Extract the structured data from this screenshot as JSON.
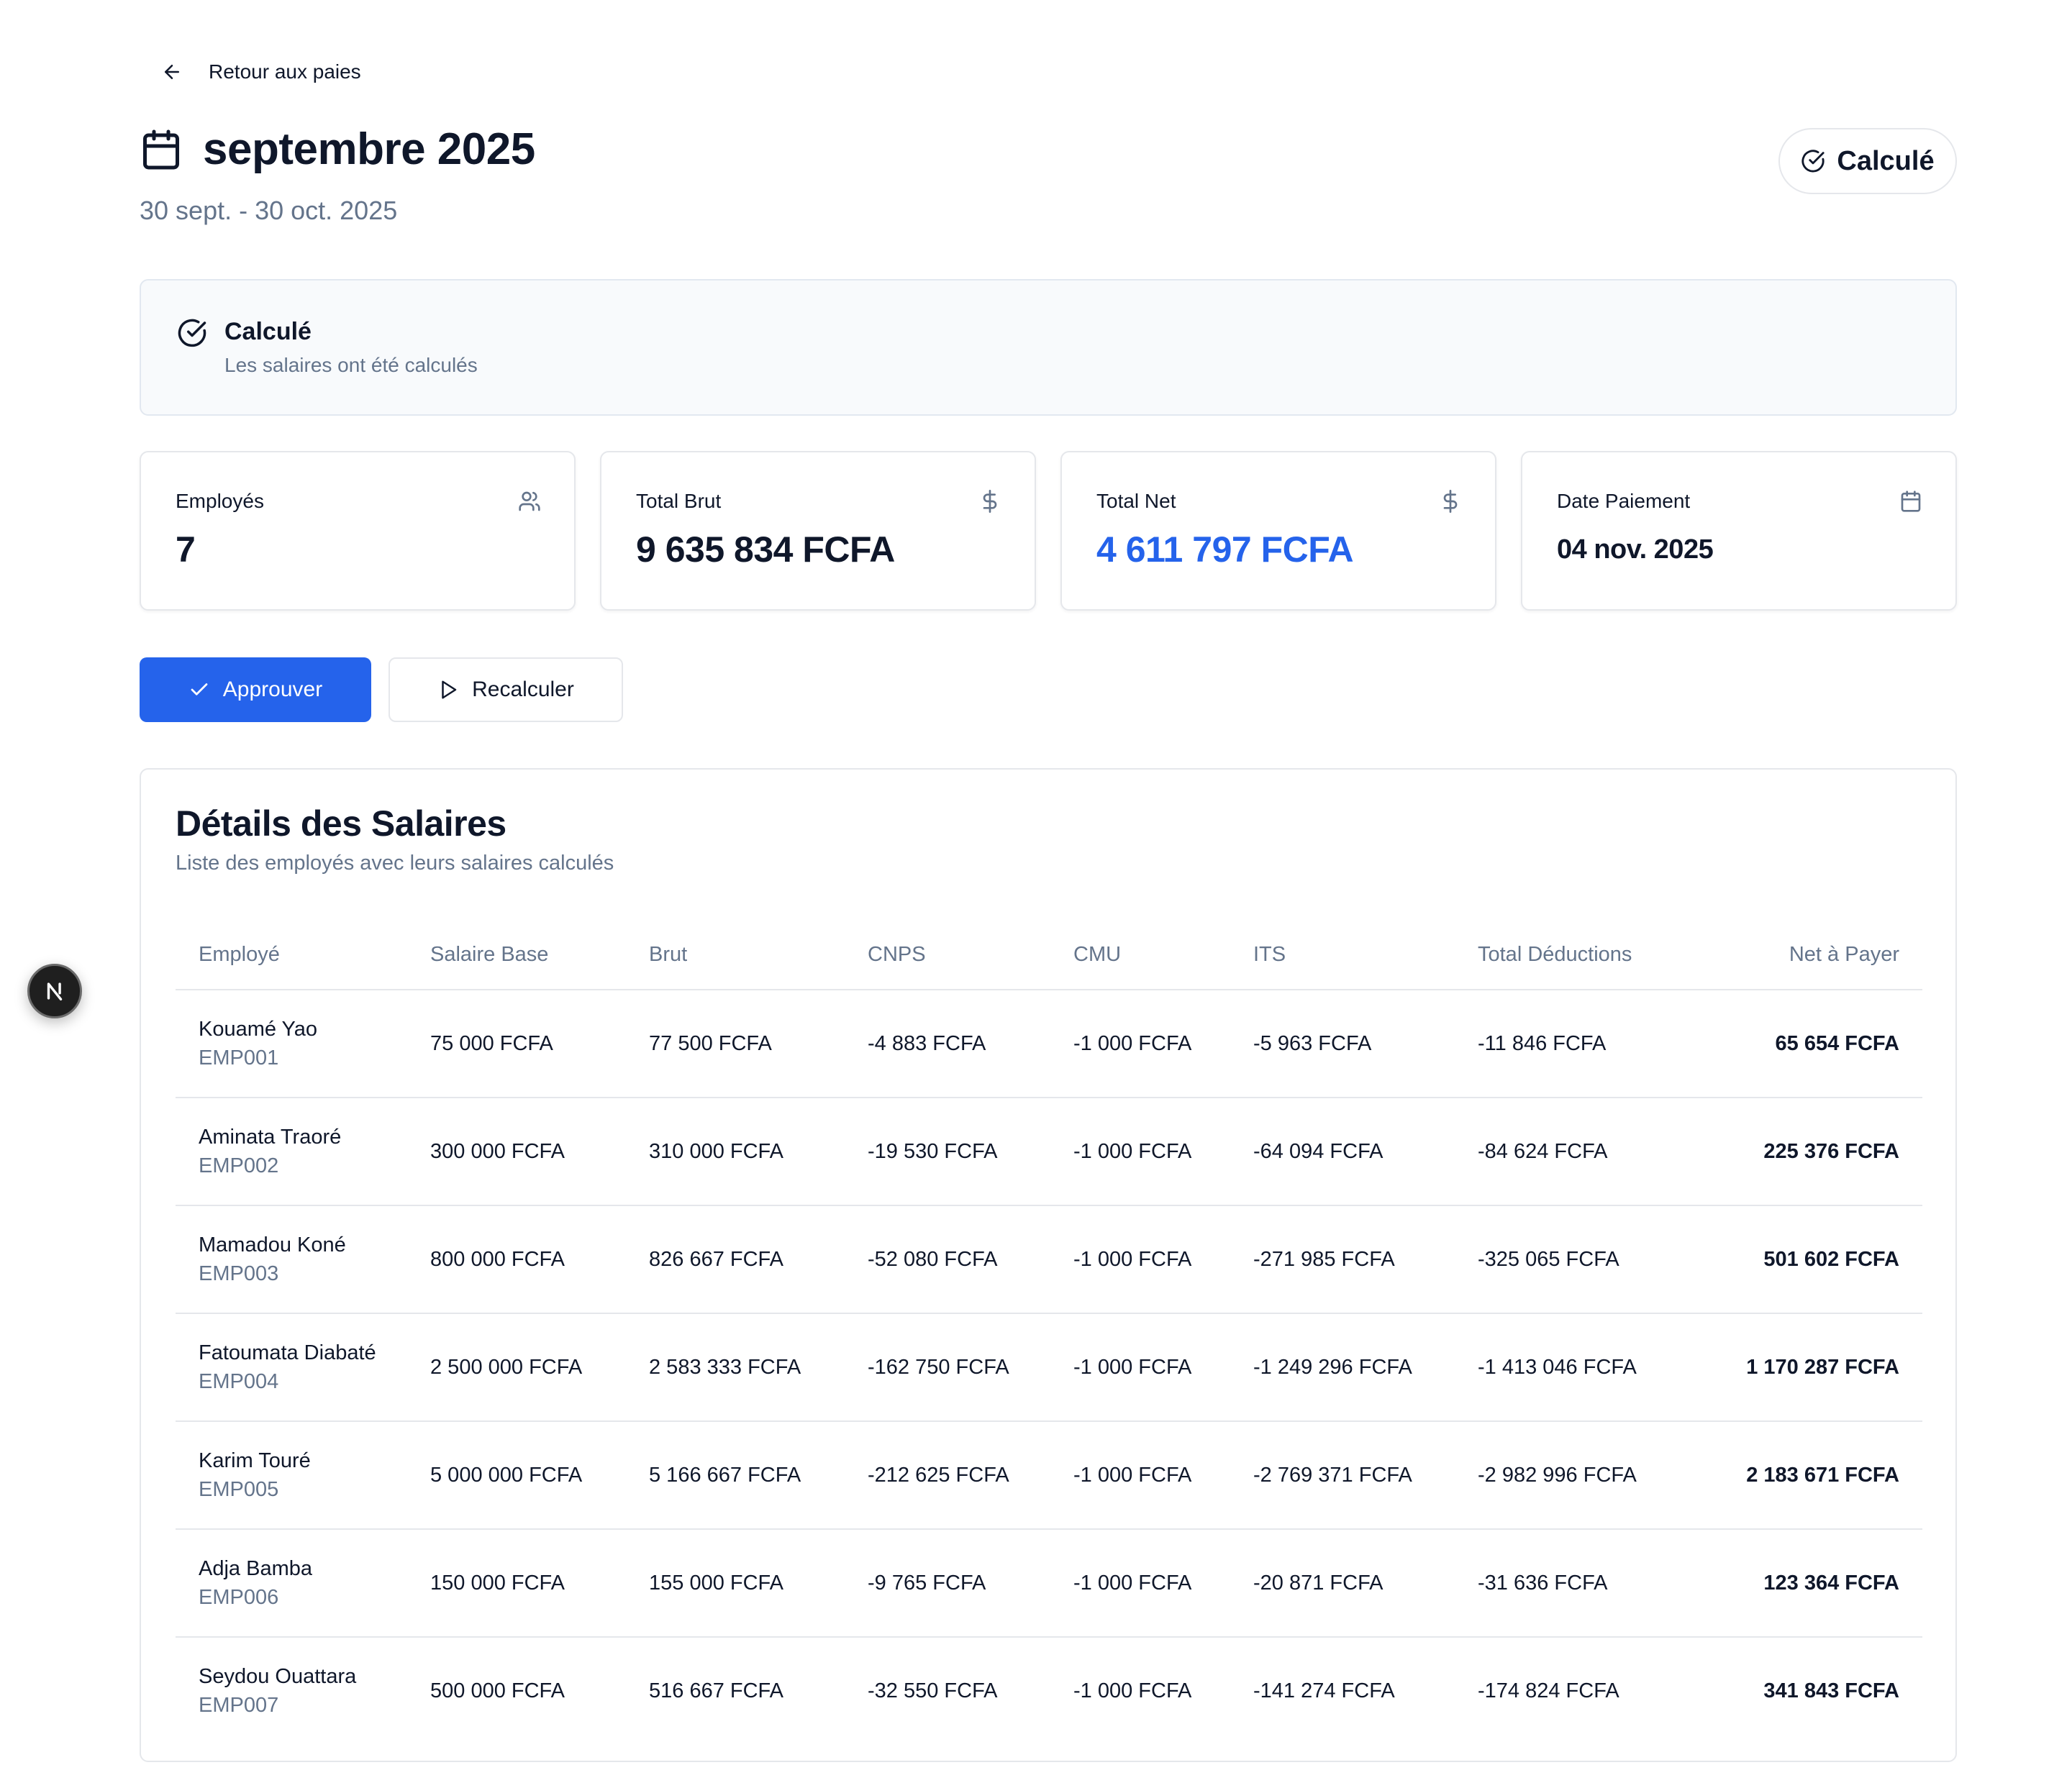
{
  "back": {
    "label": "Retour aux paies"
  },
  "header": {
    "title": "septembre 2025",
    "period": "30 sept. - 30 oct. 2025",
    "status": "Calculé"
  },
  "banner": {
    "title": "Calculé",
    "subtitle": "Les salaires ont été calculés"
  },
  "stats": [
    {
      "label": "Employés",
      "value": "7",
      "icon": "users-icon"
    },
    {
      "label": "Total Brut",
      "value": "9 635 834 FCFA",
      "icon": "dollar-icon"
    },
    {
      "label": "Total Net",
      "value": "4 611 797 FCFA",
      "icon": "dollar-icon",
      "color": "#2563eb"
    },
    {
      "label": "Date Paiement",
      "value": "04 nov. 2025",
      "icon": "calendar-icon"
    }
  ],
  "actions": {
    "approve": "Approuver",
    "recalculate": "Recalculer"
  },
  "table": {
    "title": "Détails des Salaires",
    "subtitle": "Liste des employés avec leurs salaires calculés",
    "columns": [
      "Employé",
      "Salaire Base",
      "Brut",
      "CNPS",
      "CMU",
      "ITS",
      "Total Déductions",
      "Net à Payer"
    ],
    "rows": [
      {
        "name": "Kouamé Yao",
        "id": "EMP001",
        "base": "75 000 FCFA",
        "brut": "77 500 FCFA",
        "cnps": "-4 883 FCFA",
        "cmu": "-1 000 FCFA",
        "its": "-5 963 FCFA",
        "deductions": "-11 846 FCFA",
        "net": "65 654 FCFA"
      },
      {
        "name": "Aminata Traoré",
        "id": "EMP002",
        "base": "300 000 FCFA",
        "brut": "310 000 FCFA",
        "cnps": "-19 530 FCFA",
        "cmu": "-1 000 FCFA",
        "its": "-64 094 FCFA",
        "deductions": "-84 624 FCFA",
        "net": "225 376 FCFA"
      },
      {
        "name": "Mamadou Koné",
        "id": "EMP003",
        "base": "800 000 FCFA",
        "brut": "826 667 FCFA",
        "cnps": "-52 080 FCFA",
        "cmu": "-1 000 FCFA",
        "its": "-271 985 FCFA",
        "deductions": "-325 065 FCFA",
        "net": "501 602 FCFA"
      },
      {
        "name": "Fatoumata Diabaté",
        "id": "EMP004",
        "base": "2 500 000 FCFA",
        "brut": "2 583 333 FCFA",
        "cnps": "-162 750 FCFA",
        "cmu": "-1 000 FCFA",
        "its": "-1 249 296 FCFA",
        "deductions": "-1 413 046 FCFA",
        "net": "1 170 287 FCFA"
      },
      {
        "name": "Karim Touré",
        "id": "EMP005",
        "base": "5 000 000 FCFA",
        "brut": "5 166 667 FCFA",
        "cnps": "-212 625 FCFA",
        "cmu": "-1 000 FCFA",
        "its": "-2 769 371 FCFA",
        "deductions": "-2 982 996 FCFA",
        "net": "2 183 671 FCFA"
      },
      {
        "name": "Adja Bamba",
        "id": "EMP006",
        "base": "150 000 FCFA",
        "brut": "155 000 FCFA",
        "cnps": "-9 765 FCFA",
        "cmu": "-1 000 FCFA",
        "its": "-20 871 FCFA",
        "deductions": "-31 636 FCFA",
        "net": "123 364 FCFA"
      },
      {
        "name": "Seydou Ouattara",
        "id": "EMP007",
        "base": "500 000 FCFA",
        "brut": "516 667 FCFA",
        "cnps": "-32 550 FCFA",
        "cmu": "-1 000 FCFA",
        "its": "-141 274 FCFA",
        "deductions": "-174 824 FCFA",
        "net": "341 843 FCFA"
      }
    ]
  },
  "dev_badge": {
    "icon": "nextjs-icon",
    "letter": "N"
  }
}
